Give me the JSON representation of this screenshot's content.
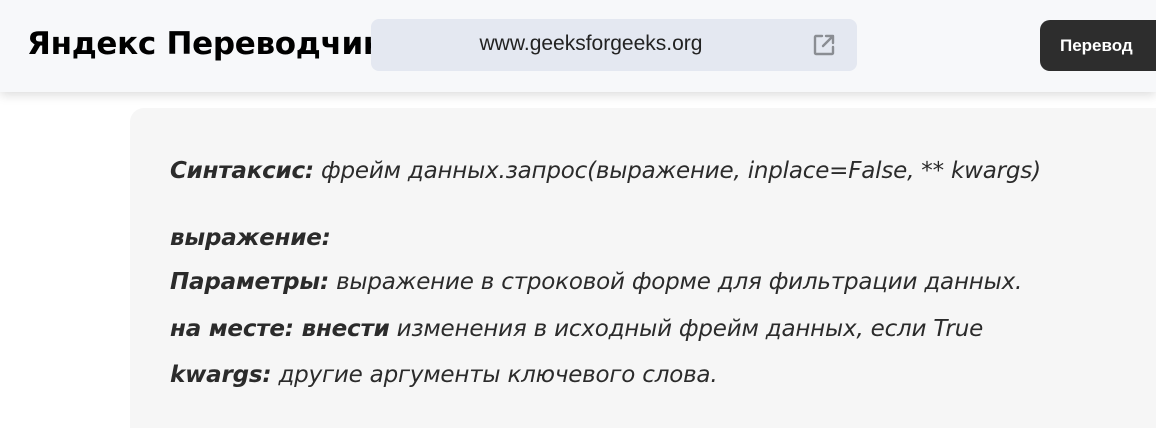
{
  "header": {
    "brand": "Яндекс Переводчик",
    "url": "www.geeksforgeeks.org",
    "open_icon": "external-link-icon",
    "translate_label": "Перевод"
  },
  "content": {
    "syntax": {
      "label": "Синтаксис:",
      "text": " фрейм данных.запрос(выражение, inplace=False, ** kwargs)"
    },
    "expr_heading": "выражение:",
    "params": {
      "label": "Параметры:",
      "text": " выражение в строковой форме для фильтрации данных."
    },
    "inplace": {
      "label": "на месте: внести",
      "text": " изменения в исходный фрейм данных, если True"
    },
    "kwargs": {
      "label": "kwargs:",
      "text": " другие аргументы ключевого слова."
    }
  },
  "colors": {
    "topbar": "#f7f8fa",
    "url_box": "#e4e8f1",
    "button": "#2d2d2d",
    "content_bg": "#f6f6f6"
  }
}
